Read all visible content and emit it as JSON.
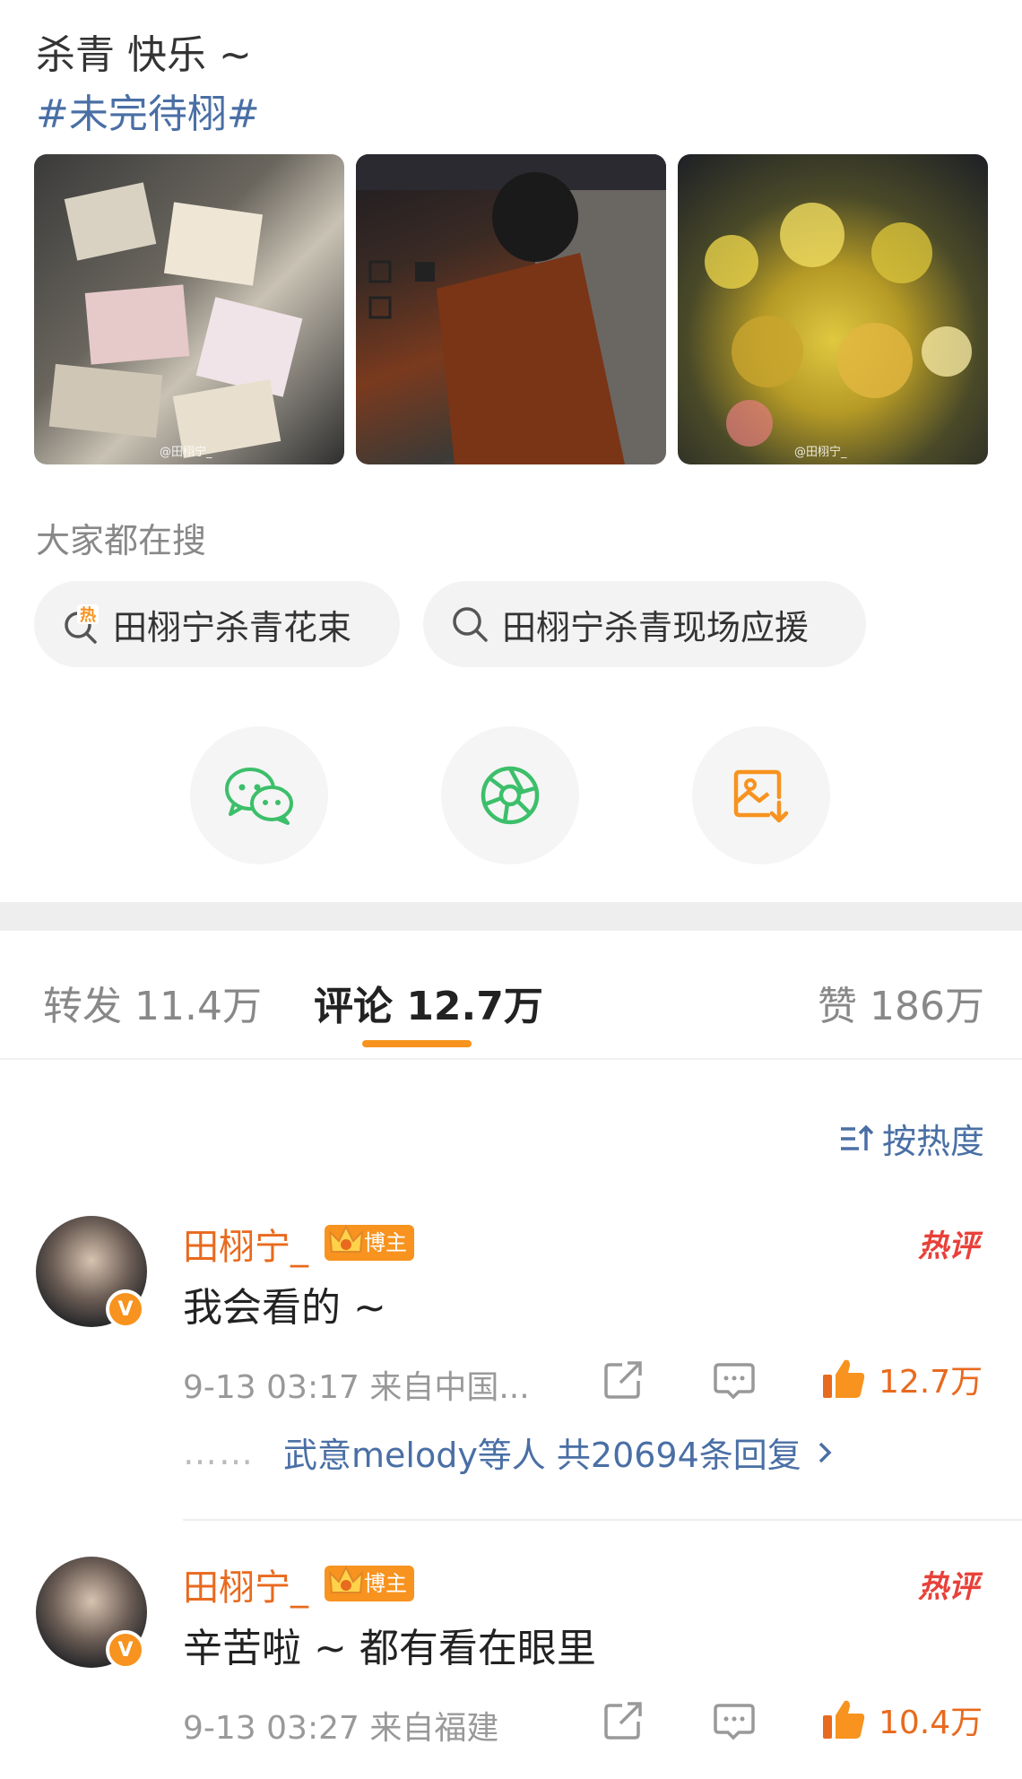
{
  "post": {
    "text": "杀青  快乐 ~",
    "hashtag": "#未完待栩#",
    "images": [
      {
        "alt": "letters",
        "watermark": "@田栩宁_"
      },
      {
        "alt": "portrait",
        "watermark": ""
      },
      {
        "alt": "flowers",
        "watermark": "@田栩宁_"
      }
    ]
  },
  "trending": {
    "title": "大家都在搜",
    "chips": [
      {
        "label": "田栩宁杀青花束",
        "icon": "hot-search-icon",
        "hot_mark": "热"
      },
      {
        "label": "田栩宁杀青现场应援",
        "icon": "search-icon"
      }
    ]
  },
  "share": {
    "buttons": [
      {
        "name": "wechat",
        "icon": "wechat-icon",
        "color": "#3cbf6a"
      },
      {
        "name": "moments",
        "icon": "moments-icon",
        "color": "#3cbf6a"
      },
      {
        "name": "save-image",
        "icon": "save-image-icon",
        "color": "#f7931e"
      }
    ]
  },
  "tabs": {
    "repost": "转发 11.4万",
    "comment": "评论 12.7万",
    "like": "赞 186万",
    "active": "comment",
    "accent": "#f7931e"
  },
  "sort": {
    "label": "按热度"
  },
  "comments": [
    {
      "user": "田栩宁_",
      "badge": "博主",
      "verified": "V",
      "hot": "热评",
      "text": "我会看的 ~",
      "meta": "9-13 03:17  来自中国...",
      "likes": "12.7万",
      "replies_dots": "……",
      "replies_text": "武意melody等人  共20694条回复"
    },
    {
      "user": "田栩宁_",
      "badge": "博主",
      "verified": "V",
      "hot": "热评",
      "text": "辛苦啦 ~ 都有看在眼里",
      "meta": "9-13 03:27  来自福建",
      "likes": "10.4万"
    }
  ],
  "colors": {
    "link": "#4a6fa5",
    "orange": "#f7931e",
    "username": "#e86a1e",
    "hot": "#e8413a"
  }
}
